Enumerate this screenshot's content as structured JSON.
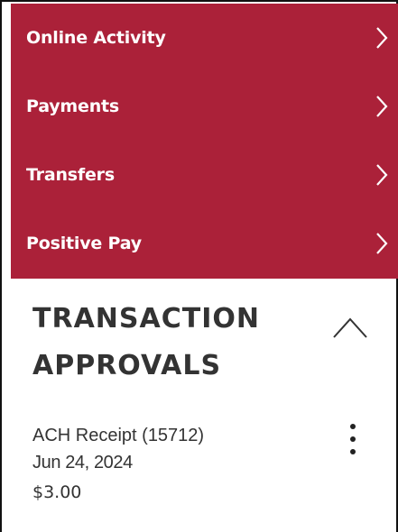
{
  "nav": {
    "items": [
      {
        "label": "Online Activity",
        "icon": "chevron-right-icon"
      },
      {
        "label": "Payments",
        "icon": "chevron-right-icon"
      },
      {
        "label": "Transfers",
        "icon": "chevron-right-icon"
      },
      {
        "label": "Positive Pay",
        "icon": "chevron-right-icon"
      }
    ],
    "background_color": "#ab2139",
    "text_color": "#ffffff"
  },
  "section": {
    "title_line1": "TRANSACTION",
    "title_line2": "APPROVALS",
    "collapse_icon": "chevron-up-icon",
    "expanded": true
  },
  "transactions": [
    {
      "name": "ACH Receipt (15712)",
      "date": "Jun 24, 2024",
      "amount": "$3.00",
      "menu_icon": "more-vertical-icon"
    }
  ]
}
